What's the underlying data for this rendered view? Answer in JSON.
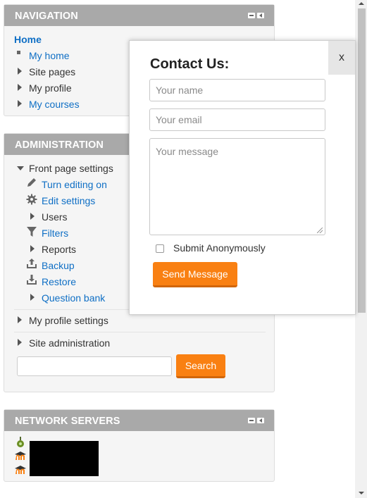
{
  "navigation": {
    "title": "NAVIGATION",
    "home": "Home",
    "items": [
      {
        "label": "My home",
        "kind": "link",
        "marker": "bullet"
      },
      {
        "label": "Site pages",
        "kind": "text",
        "marker": "triangle-right"
      },
      {
        "label": "My profile",
        "kind": "text",
        "marker": "triangle-right"
      },
      {
        "label": "My courses",
        "kind": "link",
        "marker": "triangle-right"
      }
    ]
  },
  "administration": {
    "title": "ADMINISTRATION",
    "front_page_settings": "Front page settings",
    "items": [
      {
        "label": "Turn editing on",
        "icon": "pencil-icon",
        "kind": "link"
      },
      {
        "label": "Edit settings",
        "icon": "gear-icon",
        "kind": "link"
      },
      {
        "label": "Users",
        "icon": "triangle-right",
        "kind": "text"
      },
      {
        "label": "Filters",
        "icon": "filter-icon",
        "kind": "link"
      },
      {
        "label": "Reports",
        "icon": "triangle-right",
        "kind": "text"
      },
      {
        "label": "Backup",
        "icon": "backup-icon",
        "kind": "link"
      },
      {
        "label": "Restore",
        "icon": "restore-icon",
        "kind": "link"
      },
      {
        "label": "Question bank",
        "icon": "triangle-right",
        "kind": "link"
      }
    ],
    "my_profile_settings": "My profile settings",
    "site_administration": "Site administration",
    "search": {
      "value": "",
      "button": "Search"
    }
  },
  "network_servers": {
    "title": "NETWORK SERVERS"
  },
  "contact_modal": {
    "close": "x",
    "title": "Contact Us:",
    "name_placeholder": "Your name",
    "email_placeholder": "Your email",
    "message_placeholder": "Your message",
    "anonymous_label": "Submit Anonymously",
    "anonymous_checked": false,
    "send_button": "Send Message"
  },
  "colors": {
    "header_bg": "#a9a9a9",
    "link": "#0f6fc5",
    "accent": "#f98012"
  }
}
